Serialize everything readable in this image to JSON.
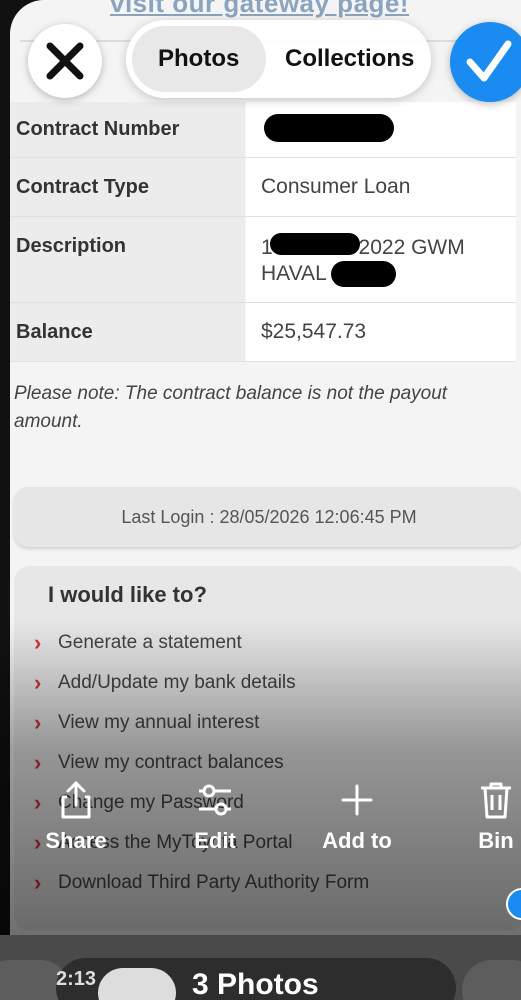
{
  "photo": {
    "gateway_link": "visit our gateway page!",
    "table": [
      {
        "label": "Contract Number",
        "value": ""
      },
      {
        "label": "Contract Type",
        "value": "Consumer Loan"
      },
      {
        "label": "Description",
        "value_prefix": "1",
        "value_mid": "2022 GWM",
        "value_line2": "HAVAL"
      },
      {
        "label": "Balance",
        "value": "$25,547.73"
      }
    ],
    "note": "Please note: The contract balance is not the payout amount.",
    "last_login": "Last Login : 28/05/2026 12:06:45 PM",
    "menu": {
      "title": "I would like to?",
      "items": [
        "Generate a statement",
        "Add/Update my bank details",
        "View my annual interest",
        "View my contract balances",
        "Change my Password",
        "Access the MyToyota Portal",
        "Download Third Party Authority Form"
      ]
    }
  },
  "viewer": {
    "tabs": [
      "Photos",
      "Collections"
    ],
    "active_tab": "Photos",
    "actions": [
      {
        "label": "Share",
        "icon": "share-icon"
      },
      {
        "label": "Edit",
        "icon": "edit-icon"
      },
      {
        "label": "Add to",
        "icon": "plus-icon"
      },
      {
        "label": "Bin",
        "icon": "trash-icon"
      }
    ],
    "selection_label": "3 Photos",
    "left_fragment": "2:13",
    "accent": "#1a8bf0"
  }
}
